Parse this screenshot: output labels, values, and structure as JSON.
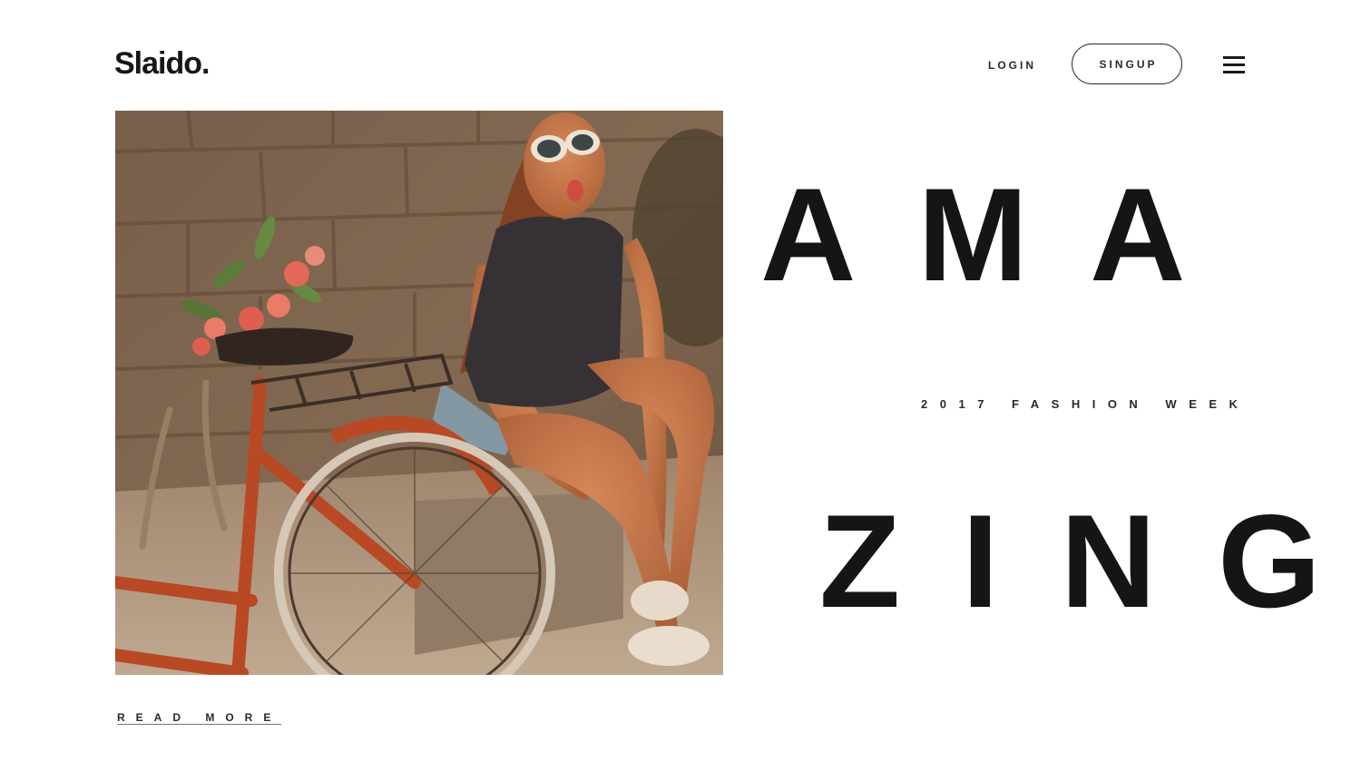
{
  "header": {
    "logo": "Slaido.",
    "login_label": "LOGIN",
    "signup_label": "SINGUP",
    "menu_icon": "hamburger-menu-icon"
  },
  "hero": {
    "image_alt": "Young woman wearing white sunglasses sitting on a concrete block next to a red bicycle and pink flowers",
    "headline_line1": "AMA",
    "headline_line2": "ZING",
    "subtitle": "2017 FASHION WEEK",
    "read_more_label": "READ MORE"
  },
  "colors": {
    "text": "#151515",
    "background": "#ffffff",
    "bicycle": "#b8401f"
  }
}
